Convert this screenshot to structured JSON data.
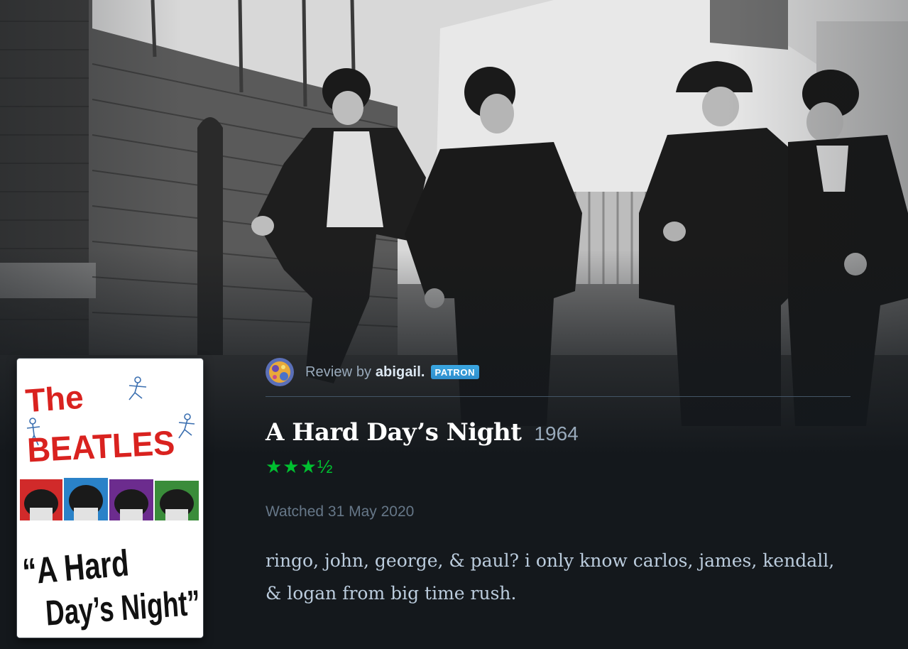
{
  "review": {
    "byline_prefix": "Review by ",
    "author": "abigail.",
    "badge": "PATRON",
    "film_title": "A Hard Day’s Night",
    "film_year": "1964",
    "rating_stars": "★★★½",
    "rating_value": 3.5,
    "watched": "Watched 31 May 2020",
    "body": "ringo, john, george, & paul? i only know carlos, james, kendall, & logan from big time rush."
  },
  "poster": {
    "line1": "The",
    "line2": "BEATLES",
    "line3": "“A Hard",
    "line4": "Day’s Night”"
  },
  "colors": {
    "background": "#14181c",
    "star": "#00c030",
    "badge": "#40bcf4"
  }
}
